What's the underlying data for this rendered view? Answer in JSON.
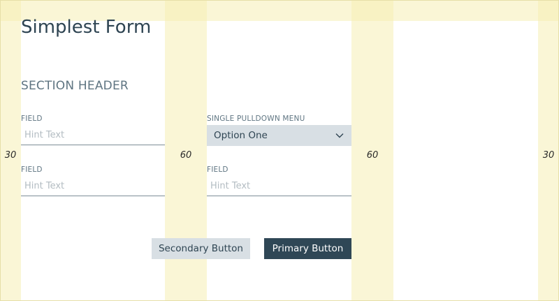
{
  "form": {
    "title": "Simplest Form",
    "section_header": "SECTION HEADER",
    "fields": [
      {
        "label": "FIELD",
        "placeholder": "Hint Text"
      },
      {
        "label": "SINGLE PULLDOWN MENU",
        "selected": "Option One"
      },
      {
        "label": "FIELD",
        "placeholder": "Hint Text"
      },
      {
        "label": "FIELD",
        "placeholder": "Hint Text"
      }
    ],
    "buttons": {
      "secondary": "Secondary Button",
      "primary": "Primary Button"
    }
  },
  "grid_overlay": {
    "margin_label": "30",
    "gutter_label": "60"
  },
  "colors": {
    "guide": "#f6efb4",
    "text": "#2e4452",
    "label": "#5f7582",
    "control_bg": "#d8dfe4",
    "primary_bg": "#2f4756"
  },
  "icons": {
    "select": "chevron-down-icon"
  }
}
